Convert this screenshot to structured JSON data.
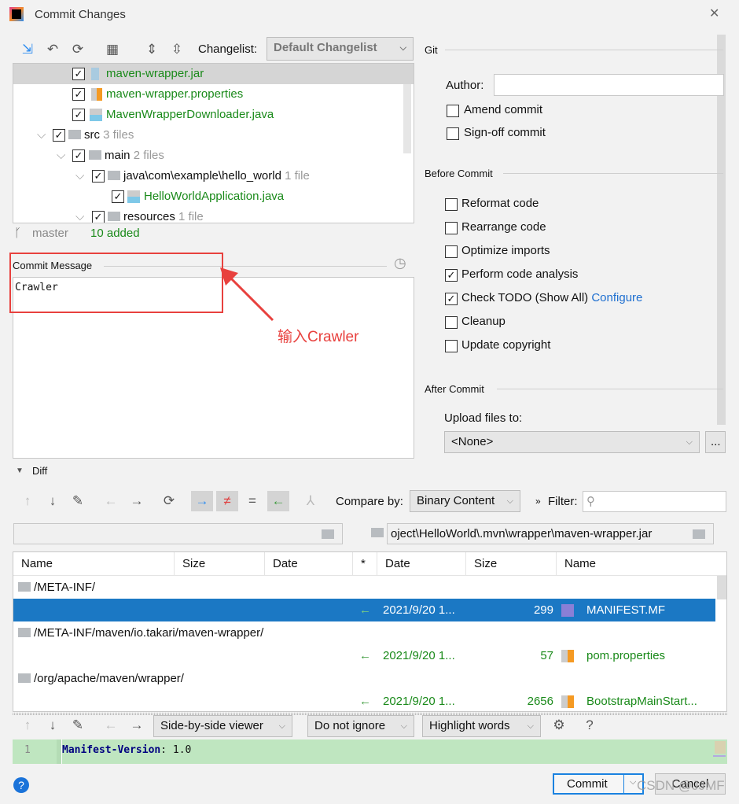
{
  "window": {
    "title": "Commit Changes",
    "close": "✕"
  },
  "toolbar": {
    "changelist_label": "Changelist:",
    "changelist_value": "Default Changelist"
  },
  "tree": [
    {
      "name": "maven-wrapper.jar",
      "count": "",
      "checked": true
    },
    {
      "name": "maven-wrapper.properties",
      "count": "",
      "checked": true
    },
    {
      "name": "MavenWrapperDownloader.java",
      "count": "",
      "checked": true
    },
    {
      "name": "src",
      "count": "3 files",
      "checked": true
    },
    {
      "name": "main",
      "count": "2 files",
      "checked": true
    },
    {
      "name": "java\\com\\example\\hello_world",
      "count": "1 file",
      "checked": true
    },
    {
      "name": "HelloWorldApplication.java",
      "count": "",
      "checked": true
    },
    {
      "name": "resources",
      "count": "1 file",
      "checked": true
    }
  ],
  "status": {
    "branch": "master",
    "added": "10 added"
  },
  "commit_message": {
    "label": "Commit Message",
    "value": "Crawler"
  },
  "annotation": {
    "text": "输入Crawler",
    "color": "#e8413e"
  },
  "git": {
    "section": "Git",
    "author_label": "Author:",
    "author_value": "",
    "amend": "Amend commit",
    "signoff": "Sign-off commit"
  },
  "before_commit": {
    "section": "Before Commit",
    "options": [
      {
        "label": "Reformat code",
        "checked": false
      },
      {
        "label": "Rearrange code",
        "checked": false
      },
      {
        "label": "Optimize imports",
        "checked": false
      },
      {
        "label": "Perform code analysis",
        "checked": true
      },
      {
        "label": "Check TODO (Show All)",
        "checked": true,
        "link": "Configure"
      },
      {
        "label": "Cleanup",
        "checked": false
      },
      {
        "label": "Update copyright",
        "checked": false
      }
    ]
  },
  "after_commit": {
    "section": "After Commit",
    "upload_label": "Upload files to:",
    "upload_value": "<None>",
    "browse": "..."
  },
  "diff": {
    "section": "Diff",
    "compare_label": "Compare by:",
    "compare_value": "Binary Content",
    "filter_label": "Filter:",
    "left_path": "",
    "right_path": "oject\\HelloWorld\\.mvn\\wrapper\\maven-wrapper.jar",
    "columns": [
      "Name",
      "Size",
      "Date",
      "*",
      "Date",
      "Size",
      "Name"
    ],
    "rows": [
      {
        "folder": "/META-INF/"
      },
      {
        "date": "2021/9/20 1...",
        "size": "299",
        "name": "MANIFEST.MF",
        "selected": true
      },
      {
        "folder": "/META-INF/maven/io.takari/maven-wrapper/"
      },
      {
        "date": "2021/9/20 1...",
        "size": "57",
        "name": "pom.properties"
      },
      {
        "folder": "/org/apache/maven/wrapper/"
      },
      {
        "date": "2021/9/20 1...",
        "size": "2656",
        "name": "BootstrapMainStart..."
      }
    ],
    "viewer": "Side-by-side viewer",
    "ignore": "Do not ignore",
    "highlight": "Highlight words",
    "line_number": "1",
    "line_key": "Manifest-Version",
    "line_value": ": 1.0"
  },
  "buttons": {
    "commit": "Commit",
    "cancel": "Cancel",
    "help": "?"
  },
  "watermark": "CSDN @JJMF",
  "colors": {
    "added": "#1a8a1a",
    "selection": "#1b78c4",
    "diff_added_bg": "#bfe6c0",
    "link": "#1e6fd0"
  }
}
